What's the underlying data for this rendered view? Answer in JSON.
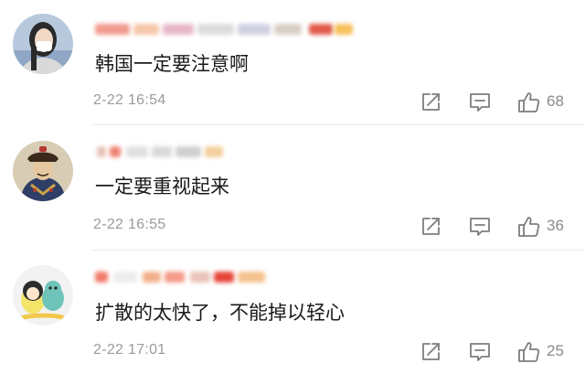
{
  "comments": [
    {
      "text": "韩国一定要注意啊",
      "timestamp": "2-22 16:54",
      "likes": "68",
      "avatar_icon": "woman-with-mask-avatar"
    },
    {
      "text": "一定要重视起来",
      "timestamp": "2-22 16:55",
      "likes": "36",
      "avatar_icon": "qing-official-portrait-avatar"
    },
    {
      "text": "扩散的太快了，不能掉以轻心",
      "timestamp": "2-22 17:01",
      "likes": "25",
      "avatar_icon": "cartoon-characters-avatar"
    }
  ],
  "icons": {
    "share": "share-icon",
    "reply": "comment-icon",
    "like": "thumbs-up-icon"
  },
  "colors": {
    "text": "#1a1a1a",
    "meta": "#9b9b9b",
    "icon": "#7d7d7d",
    "divider": "#ececec"
  }
}
